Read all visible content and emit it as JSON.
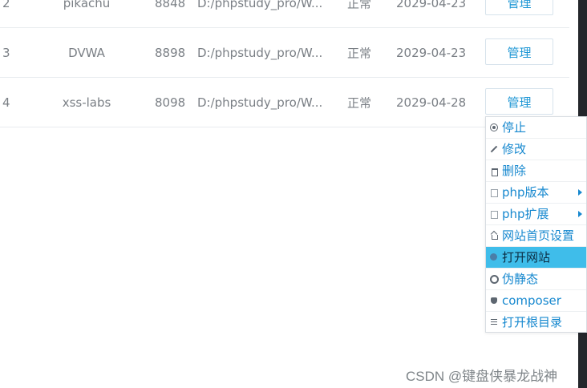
{
  "rows": [
    {
      "id": "2",
      "name": "pikachu",
      "port": "8848",
      "path": "D:/phpstudy_pro/W...",
      "status": "正常",
      "date": "2029-04-23",
      "manage": "管理"
    },
    {
      "id": "3",
      "name": "DVWA",
      "port": "8898",
      "path": "D:/phpstudy_pro/W...",
      "status": "正常",
      "date": "2029-04-23",
      "manage": "管理"
    },
    {
      "id": "4",
      "name": "xss-labs",
      "port": "8098",
      "path": "D:/phpstudy_pro/W...",
      "status": "正常",
      "date": "2029-04-28",
      "manage": "管理"
    }
  ],
  "menu": {
    "items": [
      {
        "label": "停止",
        "icon": "stop-icon"
      },
      {
        "label": "修改",
        "icon": "edit-icon"
      },
      {
        "label": "删除",
        "icon": "delete-icon"
      },
      {
        "label": "php版本",
        "icon": "php-version-icon"
      },
      {
        "label": "php扩展",
        "icon": "php-extension-icon"
      },
      {
        "label": "网站首页设置",
        "icon": "home-icon"
      },
      {
        "label": "打开网站",
        "icon": "globe-icon"
      },
      {
        "label": "伪静态",
        "icon": "cycle-icon"
      },
      {
        "label": "composer",
        "icon": "composer-icon"
      },
      {
        "label": "打开根目录",
        "icon": "list-icon"
      }
    ]
  },
  "colors": {
    "accent": "#1688cf",
    "active_background": "#3fbdea",
    "text_muted": "#7a7f85"
  },
  "watermark": "CSDN @键盘侠暴龙战神"
}
